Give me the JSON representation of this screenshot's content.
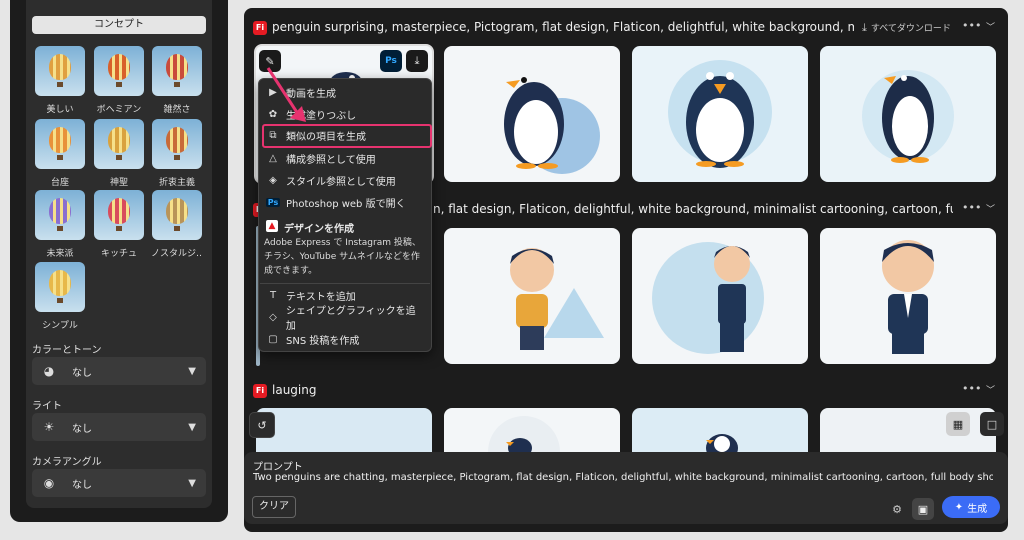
{
  "sidebar": {
    "concept_button": "コンセプト",
    "styles": [
      {
        "label": "美しい",
        "color": "#e0a040"
      },
      {
        "label": "ボヘミアン",
        "color": "#d8602a"
      },
      {
        "label": "雑然さ",
        "color": "#c94b3b"
      },
      {
        "label": "台座",
        "color": "#e8923a"
      },
      {
        "label": "神聖",
        "color": "#d9a23e"
      },
      {
        "label": "折衷主義",
        "color": "#c86a38"
      },
      {
        "label": "未来派",
        "color": "#8a6fd0"
      },
      {
        "label": "キッチュ",
        "color": "#d84c5c"
      },
      {
        "label": "ノスタルジ…",
        "color": "#b99458"
      },
      {
        "label": "シンプル",
        "color": "#e7b84a"
      }
    ],
    "color_tone_label": "カラーとトーン",
    "color_tone_value": "なし",
    "light_label": "ライト",
    "light_value": "なし",
    "camera_label": "カメラアングル",
    "camera_value": "なし"
  },
  "rows": [
    {
      "title": "penguin surprising, masterpiece, Pictogram, flat design, Flaticon, delightful, white background, minimalist cartooning, c",
      "download_all": "すべてダウンロード"
    },
    {
      "title": "n, flat design, Flaticon, delightful, white background, minimalist cartooning, cartoon, full body shot"
    },
    {
      "title": "lauging"
    }
  ],
  "context_menu": {
    "items": [
      {
        "label": "動画を生成",
        "icon": "video-icon"
      },
      {
        "label": "生成塗りつぶし",
        "icon": "fill-icon"
      },
      {
        "label": "類似の項目を生成",
        "icon": "similar-icon"
      },
      {
        "label": "構成参照として使用",
        "icon": "composition-icon"
      },
      {
        "label": "スタイル参照として使用",
        "icon": "style-icon"
      },
      {
        "label": "Photoshop web 版で開く",
        "icon": "photoshop-icon"
      }
    ],
    "design_title": "デザインを作成",
    "design_desc": "Adobe Express で Instagram 投稿、チラシ、YouTube サムネイルなどを作成できます。",
    "bottom_items": [
      {
        "label": "テキストを追加",
        "icon": "text-icon"
      },
      {
        "label": "シェイプとグラフィックを追加",
        "icon": "shapes-icon"
      },
      {
        "label": "SNS 投稿を作成",
        "icon": "sns-icon"
      }
    ]
  },
  "prompt": {
    "label": "プロンプト",
    "text": "Two penguins are chatting, masterpiece, Pictogram, flat design, Flaticon, delightful, white background, minimalist cartooning, cartoon, full body shot",
    "clear": "クリア",
    "generate": "生成"
  },
  "ps_badge": "Ps",
  "fi_badge": "Fi",
  "colors": {
    "accent": "#3b6cf6",
    "highlight": "#e6336f",
    "adobe_red": "#e51b23"
  }
}
